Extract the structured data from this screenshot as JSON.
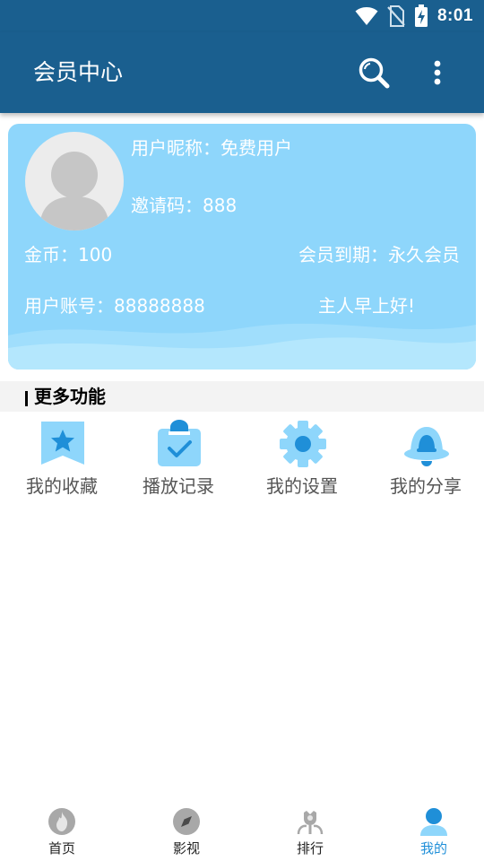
{
  "status_bar": {
    "time": "8:01",
    "icons": [
      "wifi-icon",
      "no-sim-icon",
      "battery-charging-icon"
    ]
  },
  "app_bar": {
    "title": "会员中心",
    "icons": [
      "search-icon",
      "more-vert-icon"
    ]
  },
  "member_card": {
    "nickname": "用户昵称：免费用户",
    "invite_code": "邀请码：888",
    "coins": "金币：100",
    "expiry": "会员到期：永久会员",
    "account": "用户账号：88888888",
    "greeting": "主人早上好!",
    "avatar_icon": "user-avatar-icon"
  },
  "more_features": {
    "title": "更多功能",
    "items": [
      {
        "label": "我的收藏",
        "icon": "star-bookmark-icon"
      },
      {
        "label": "播放记录",
        "icon": "clipboard-check-icon"
      },
      {
        "label": "我的设置",
        "icon": "gear-icon"
      },
      {
        "label": "我的分享",
        "icon": "bell-icon"
      }
    ]
  },
  "bottom_nav": {
    "items": [
      {
        "label": "首页",
        "icon": "flame-icon",
        "active": false
      },
      {
        "label": "影视",
        "icon": "compass-icon",
        "active": false
      },
      {
        "label": "排行",
        "icon": "trophy-icon",
        "active": false
      },
      {
        "label": "我的",
        "icon": "person-icon",
        "active": true
      }
    ]
  },
  "colors": {
    "app_bar": "#1a5f8f",
    "card": "#8ed6fb",
    "feature_icon": "#8ed6fb",
    "feature_icon_accent": "#1f8fd8",
    "nav_active": "#1f8fd8",
    "nav_inactive": "#a8a8a8"
  }
}
